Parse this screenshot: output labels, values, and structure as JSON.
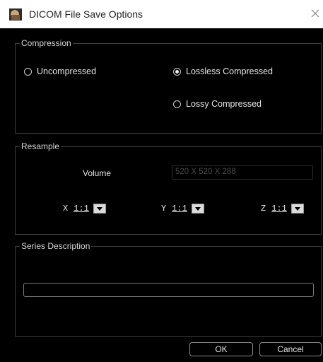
{
  "window": {
    "title": "DICOM File Save Options",
    "close_icon": "close-icon"
  },
  "compression": {
    "legend": "Compression",
    "options": [
      {
        "label": "Uncompressed",
        "checked": false
      },
      {
        "label": "Lossless Compressed",
        "checked": true
      },
      {
        "label": "Lossy Compressed",
        "checked": false
      }
    ]
  },
  "resample": {
    "legend": "Resample",
    "volume_label": "Volume",
    "volume_value": "520 X 520 X 288",
    "axes": [
      {
        "letter": "X",
        "value": "1:1"
      },
      {
        "letter": "Y",
        "value": "1:1"
      },
      {
        "letter": "Z",
        "value": "1:1"
      }
    ]
  },
  "series": {
    "legend": "Series Description",
    "value": ""
  },
  "buttons": {
    "ok": "OK",
    "cancel": "Cancel"
  }
}
